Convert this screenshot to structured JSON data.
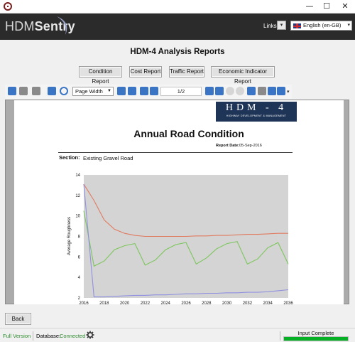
{
  "app": {
    "brand_first": "HDM",
    "brand_second": "Sentry",
    "links_label": "Links:",
    "language": "English (en-GB)"
  },
  "page": {
    "title": "HDM-4 Analysis Reports"
  },
  "report_buttons": [
    "Condition Report",
    "Cost Report",
    "Traffic Report",
    "Economic Indicator Report"
  ],
  "viewer": {
    "zoom": "Page Width",
    "page_indicator": "1/2"
  },
  "report": {
    "logo_main": "HDM - 4",
    "logo_sub": "HIGHWAY DEVELOPMENT & MANAGEMENT",
    "title": "Annual Road Condition",
    "date_label": "Report Date:",
    "date_value": "05-Sep-2016",
    "section_label": "Section:",
    "section_value": "Existing Gravel Road"
  },
  "chart_data": {
    "type": "line",
    "ylabel": "Average Roughness",
    "xlabel": "",
    "y_ticks": [
      "14",
      "12",
      "10",
      "8",
      "6",
      "4",
      "2"
    ],
    "x_ticks": [
      "2016",
      "2018",
      "2020",
      "2022",
      "2024",
      "2026",
      "2028",
      "2030",
      "2032",
      "2034",
      "2036"
    ],
    "ylim": [
      2,
      14
    ],
    "xlim": [
      2016,
      2036
    ],
    "grid": false,
    "background": "#d4d4d4",
    "x": [
      2016,
      2017,
      2018,
      2019,
      2020,
      2021,
      2022,
      2023,
      2024,
      2025,
      2026,
      2027,
      2028,
      2029,
      2030,
      2031,
      2032,
      2033,
      2034,
      2035,
      2036
    ],
    "series": [
      {
        "color": "#e07b5f",
        "values": [
          13.1,
          11.5,
          9.6,
          8.7,
          8.3,
          8.1,
          8.0,
          8.0,
          8.0,
          8.0,
          8.0,
          8.05,
          8.05,
          8.1,
          8.1,
          8.15,
          8.2,
          8.2,
          8.25,
          8.3,
          8.3
        ]
      },
      {
        "color": "#7dc65c",
        "values": [
          10.5,
          5.1,
          5.6,
          6.7,
          7.1,
          7.3,
          5.2,
          5.7,
          6.7,
          7.2,
          7.4,
          5.3,
          5.9,
          6.8,
          7.3,
          7.5,
          5.3,
          5.8,
          6.9,
          7.4,
          5.3
        ]
      },
      {
        "color": "#9090e0",
        "values": [
          13.1,
          2.1,
          2.1,
          2.15,
          2.2,
          2.25,
          2.25,
          2.3,
          2.3,
          2.35,
          2.4,
          2.4,
          2.45,
          2.45,
          2.5,
          2.5,
          2.55,
          2.55,
          2.6,
          2.7,
          2.8
        ]
      }
    ]
  },
  "bottom": {
    "back_label": "Back"
  },
  "status": {
    "version": "Full Version",
    "db_label": "Database:",
    "db_status": "Connected",
    "input_label": "Input Complete",
    "input_progress": 1.0,
    "green": "#2e8b2e"
  }
}
